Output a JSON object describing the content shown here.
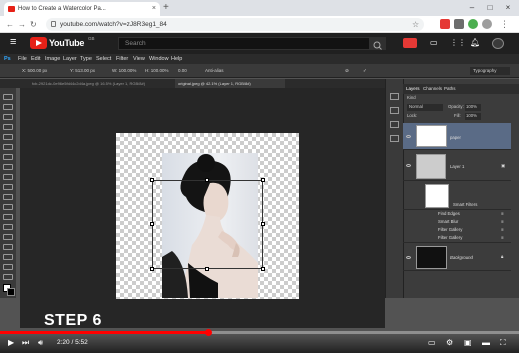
{
  "browser": {
    "tab_title": "How to Create a Watercolor Pa...",
    "tab_close": "×",
    "new_tab": "+",
    "window_controls": [
      "–",
      "□",
      "×"
    ],
    "nav": [
      "←",
      "→",
      "↻"
    ],
    "url": "youtube.com/watch?v=zJ8R3eg1_84",
    "star": "☆"
  },
  "youtube": {
    "brand": "YouTube",
    "country": "GB",
    "search_placeholder": "Search",
    "menu_icon": "≡"
  },
  "photoshop": {
    "logo": "Ps",
    "menu": [
      "File",
      "Edit",
      "Image",
      "Layer",
      "Type",
      "Select",
      "Filter",
      "View",
      "Window",
      "Help"
    ],
    "options": {
      "x": "X: 500.00 px",
      "y": "Y: 513.00 px",
      "w": "W: 100.00%",
      "h": "H: 100.00%",
      "angle": "0.00",
      "interp": "Anti-alias",
      "workspace": "Typography"
    },
    "doc_tabs": [
      "fcb-2921dc-0e96e5fd44c2d4a.jpeg @ 16.5% (Layer 1, RGB/8#)",
      "original.jpeg @ 42.1% (Layer 1, RGB/8#)"
    ],
    "panel_tabs": [
      "Layers",
      "Channels",
      "Paths"
    ],
    "kind": "Kind",
    "blend_mode": "Normal",
    "opacity_label": "Opacity:",
    "opacity": "100%",
    "lock_label": "Lock:",
    "fill_label": "Fill:",
    "fill": "100%",
    "layers": [
      {
        "name": "paper"
      },
      {
        "name": "Layer 1"
      },
      {
        "name": "Smart Filters"
      },
      {
        "name": "Find Edges"
      },
      {
        "name": "Smart Blur"
      },
      {
        "name": "Filter Gallery"
      },
      {
        "name": "Filter Gallery"
      },
      {
        "name": "Background"
      }
    ]
  },
  "overlay": {
    "step": "STEP 6"
  },
  "player": {
    "time": "2:20 / 5:52",
    "progress": 0.4
  }
}
